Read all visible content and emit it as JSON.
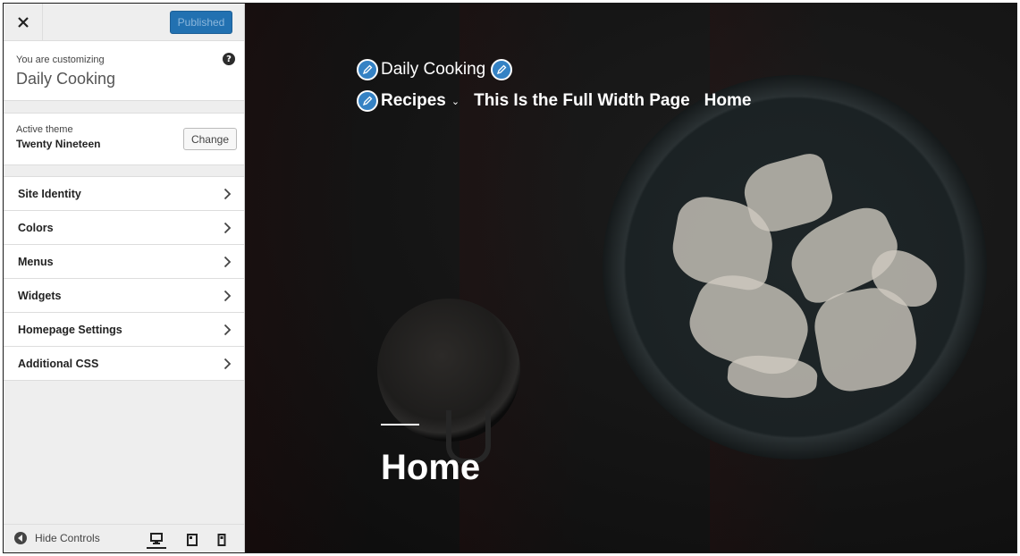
{
  "sidebar": {
    "close_label": "×",
    "publish_label": "Published",
    "customizing_label": "You are customizing",
    "site_name": "Daily Cooking",
    "help_label": "?",
    "active_theme_label": "Active theme",
    "active_theme_name": "Twenty Nineteen",
    "change_label": "Change",
    "items": [
      {
        "label": "Site Identity"
      },
      {
        "label": "Colors"
      },
      {
        "label": "Menus"
      },
      {
        "label": "Widgets"
      },
      {
        "label": "Homepage Settings"
      },
      {
        "label": "Additional CSS"
      }
    ],
    "hide_controls_label": "Hide Controls"
  },
  "preview": {
    "site_title": "Daily Cooking",
    "nav": [
      "Recipes",
      "This Is the Full Width Page",
      "Home"
    ],
    "nav_dropdown_glyph": "⌄",
    "page_title": "Home"
  },
  "colors": {
    "accent": "#2271b1",
    "edit_shortcut": "#3582c4"
  }
}
